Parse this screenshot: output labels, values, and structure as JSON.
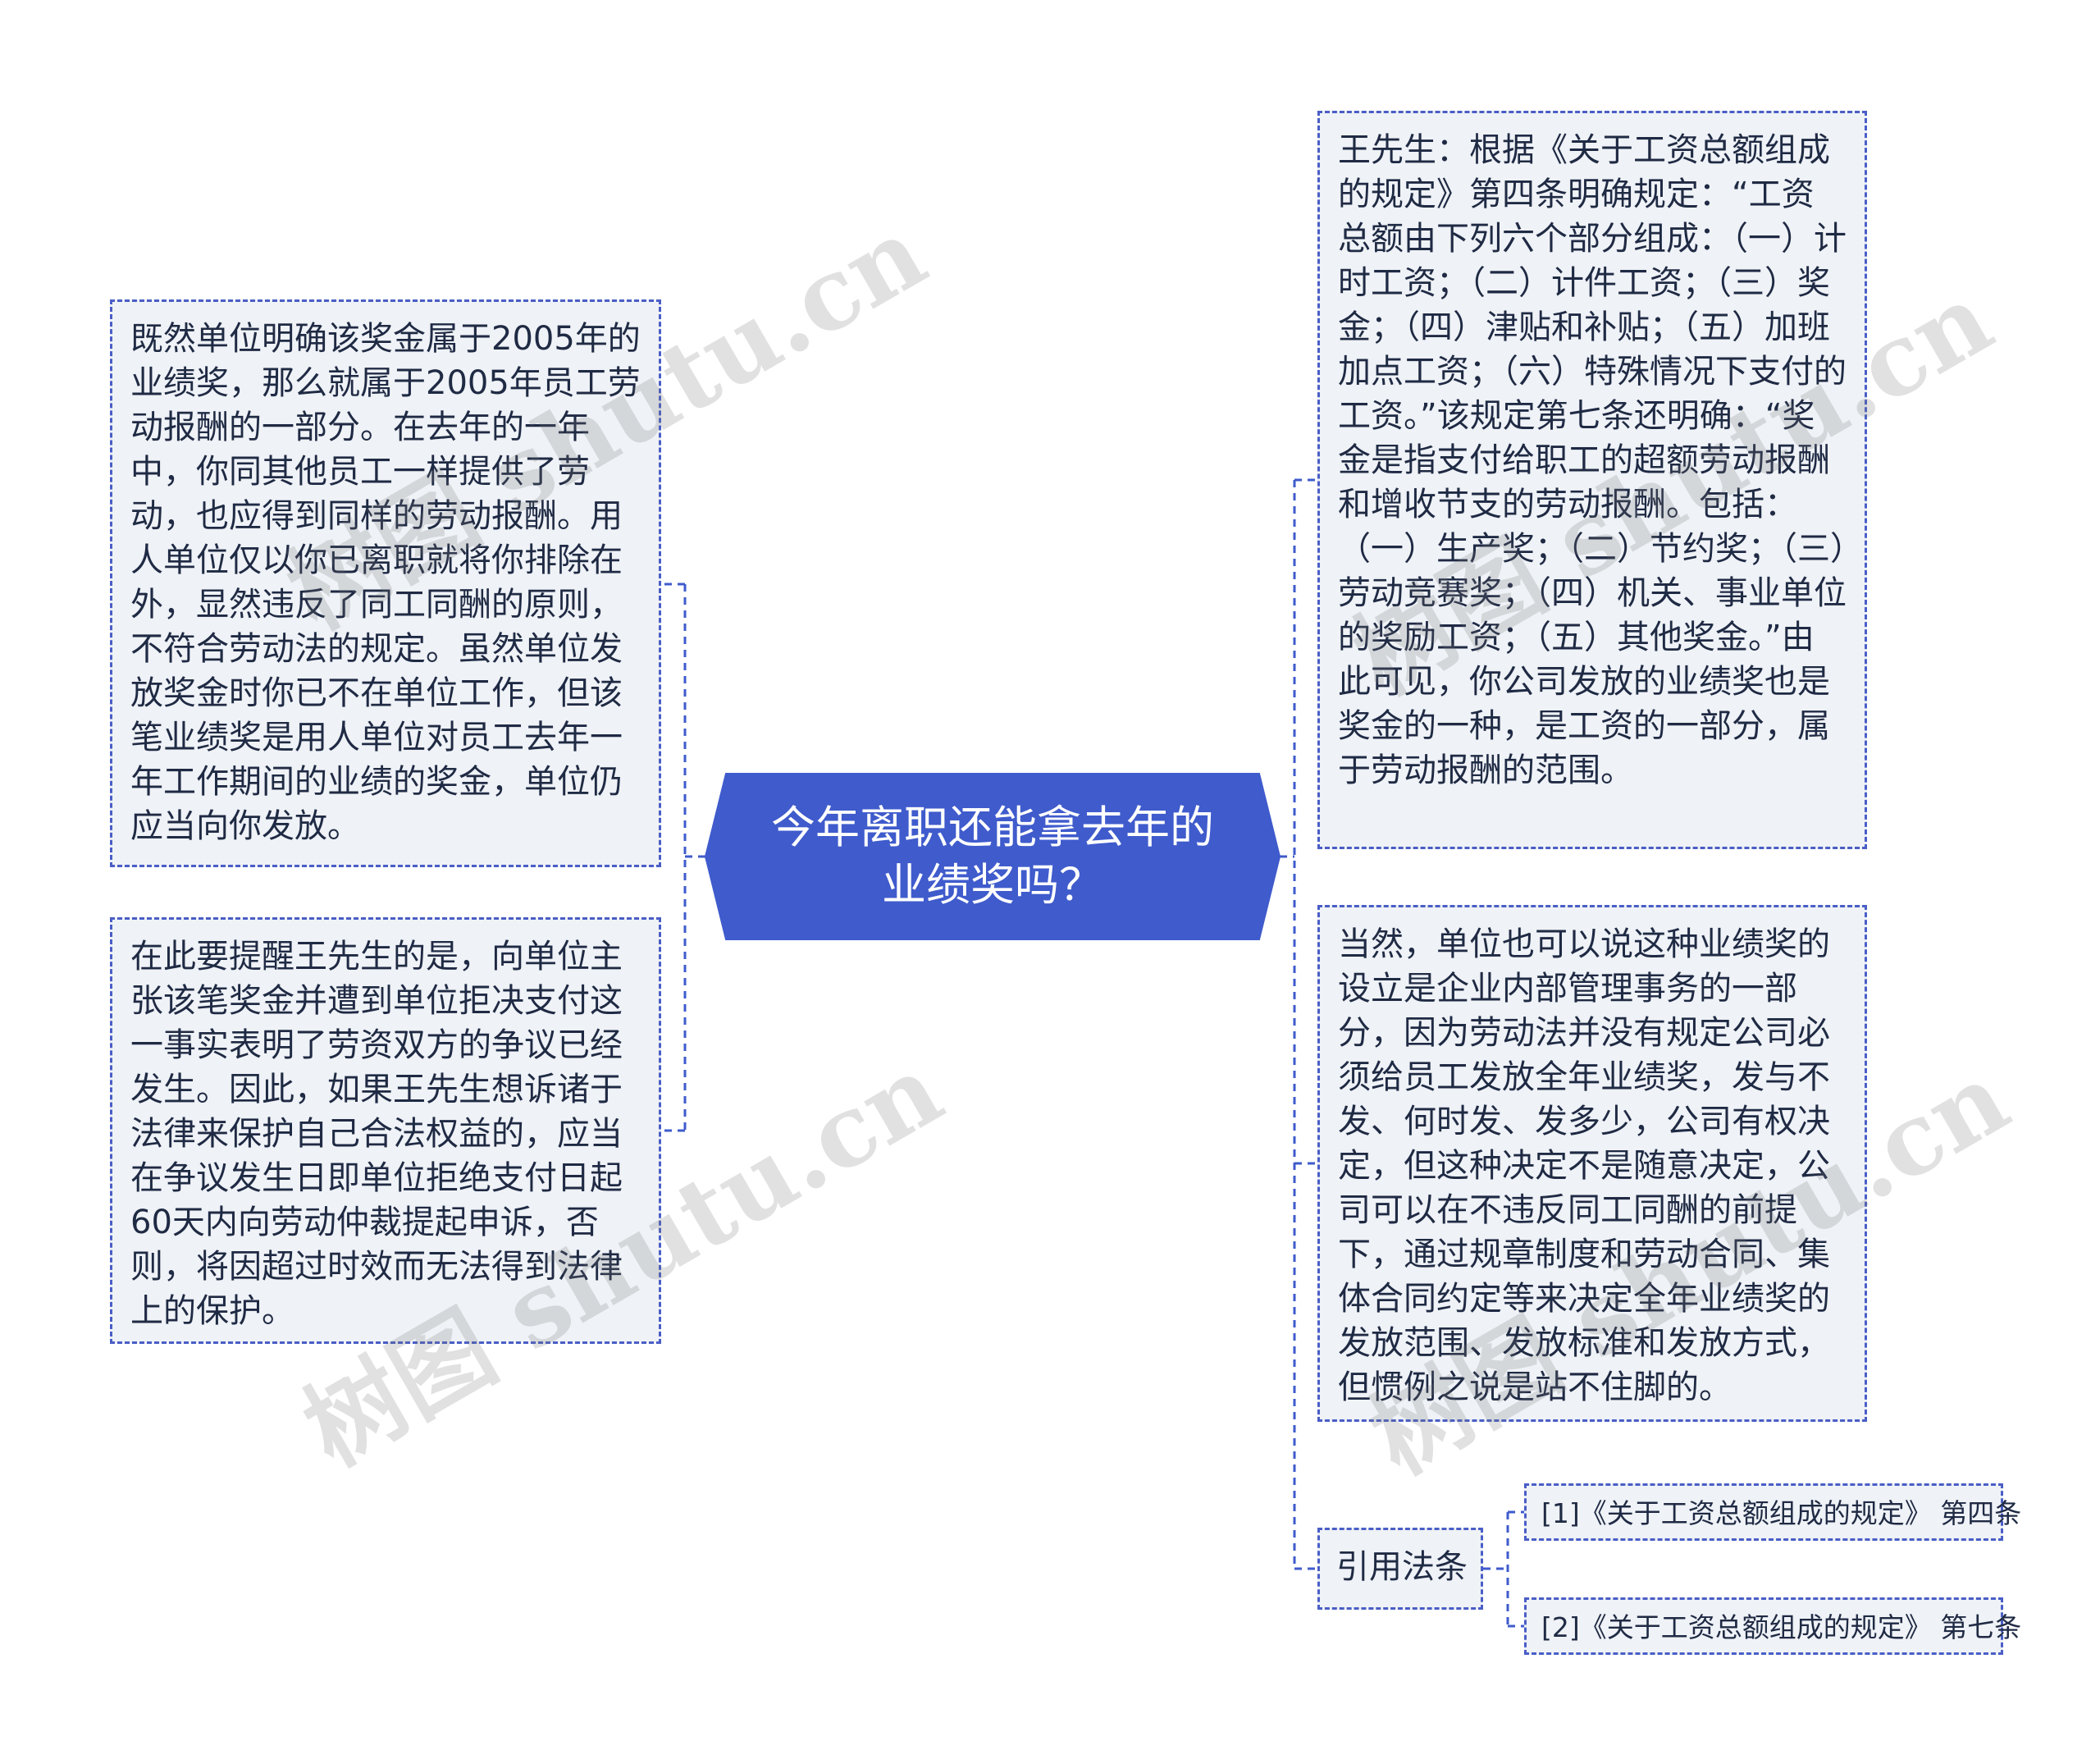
{
  "center": {
    "title": "今年离职还能拿去年的业绩奖吗？"
  },
  "left_nodes": [
    {
      "text": "既然单位明确该奖金属于2005年的业绩奖，那么就属于2005年员工劳动报酬的一部分。在去年的一年中，你同其他员工一样提供了劳动，也应得到同样的劳动报酬。用人单位仅以你已离职就将你排除在外，显然违反了同工同酬的原则，不符合劳动法的规定。虽然单位发放奖金时你已不在单位工作，但该笔业绩奖是用人单位对员工去年一年工作期间的业绩的奖金，单位仍应当向你发放。"
    },
    {
      "text": "在此要提醒王先生的是，向单位主张该笔奖金并遭到单位拒决支付这一事实表明了劳资双方的争议已经发生。因此，如果王先生想诉诸于法律来保护自己合法权益的，应当在争议发生日即单位拒绝支付日起60天内向劳动仲裁提起申诉，否则，将因超过时效而无法得到法律上的保护。"
    }
  ],
  "right_nodes": [
    {
      "text": "王先生：根据《关于工资总额组成的规定》第四条明确规定：“工资总额由下列六个部分组成：（一）计时工资；（二）计件工资；（三）奖金；（四）津贴和补贴；（五）加班加点工资；（六）特殊情况下支付的工资。”该规定第七条还明确：“奖金是指支付给职工的超额劳动报酬和增收节支的劳动报酬。包括：（一）生产奖；（二）节约奖；（三）劳动竞赛奖；（四）机关、事业单位的奖励工资；（五）其他奖金。”由此可见，你公司发放的业绩奖也是奖金的一种，是工资的一部分，属于劳动报酬的范围。"
    },
    {
      "text": "当然，单位也可以说这种业绩奖的设立是企业内部管理事务的一部分，因为劳动法并没有规定公司必须给员工发放全年业绩奖，发与不发、何时发、发多少，公司有权决定，但这种决定不是随意决定，公司可以在不违反同工同酬的前提下，通过规章制度和劳动合同、集体合同约定等来决定全年业绩奖的发放范围、发放标准和发放方式，但惯例之说是站不住脚的。"
    },
    {
      "text": "引用法条"
    }
  ],
  "citations": [
    {
      "text": "[1]《关于工资总额组成的规定》 第四条"
    },
    {
      "text": "[2]《关于工资总额组成的规定》 第七条"
    }
  ],
  "watermark": {
    "text": "树图 shutu.cn"
  },
  "colors": {
    "accent": "#3f5bcc",
    "node_bg": "#eff2f6",
    "border": "#4a5ec6",
    "line": "#3f5bcc"
  }
}
